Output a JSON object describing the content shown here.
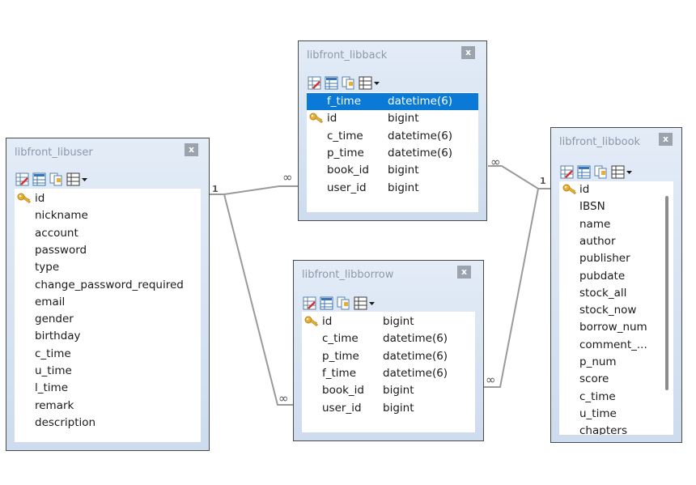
{
  "tables": {
    "libuser": {
      "title": "libfront_libuser",
      "close": "x",
      "fields": [
        {
          "name": "id",
          "type": ""
        },
        {
          "name": "nickname",
          "type": ""
        },
        {
          "name": "account",
          "type": ""
        },
        {
          "name": "password",
          "type": ""
        },
        {
          "name": "type",
          "type": ""
        },
        {
          "name": "change_password_required",
          "type": ""
        },
        {
          "name": "email",
          "type": ""
        },
        {
          "name": "gender",
          "type": ""
        },
        {
          "name": "birthday",
          "type": ""
        },
        {
          "name": "c_time",
          "type": ""
        },
        {
          "name": "u_time",
          "type": ""
        },
        {
          "name": "l_time",
          "type": ""
        },
        {
          "name": "remark",
          "type": ""
        },
        {
          "name": "description",
          "type": ""
        }
      ]
    },
    "libback": {
      "title": "libfront_libback",
      "close": "x",
      "fields": [
        {
          "name": "f_time",
          "type": "datetime(6)"
        },
        {
          "name": "id",
          "type": "bigint"
        },
        {
          "name": "c_time",
          "type": "datetime(6)"
        },
        {
          "name": "p_time",
          "type": "datetime(6)"
        },
        {
          "name": "book_id",
          "type": "bigint"
        },
        {
          "name": "user_id",
          "type": "bigint"
        }
      ]
    },
    "libborrow": {
      "title": "libfront_libborrow",
      "close": "x",
      "fields": [
        {
          "name": "id",
          "type": "bigint"
        },
        {
          "name": "c_time",
          "type": "datetime(6)"
        },
        {
          "name": "p_time",
          "type": "datetime(6)"
        },
        {
          "name": "f_time",
          "type": "datetime(6)"
        },
        {
          "name": "book_id",
          "type": "bigint"
        },
        {
          "name": "user_id",
          "type": "bigint"
        }
      ]
    },
    "libbook": {
      "title": "libfront_libbook",
      "close": "x",
      "fields": [
        {
          "name": "id",
          "type": ""
        },
        {
          "name": "IBSN",
          "type": ""
        },
        {
          "name": "name",
          "type": ""
        },
        {
          "name": "author",
          "type": ""
        },
        {
          "name": "publisher",
          "type": ""
        },
        {
          "name": "pubdate",
          "type": ""
        },
        {
          "name": "stock_all",
          "type": ""
        },
        {
          "name": "stock_now",
          "type": ""
        },
        {
          "name": "borrow_num",
          "type": ""
        },
        {
          "name": "comment_...",
          "type": ""
        },
        {
          "name": "p_num",
          "type": ""
        },
        {
          "name": "score",
          "type": ""
        },
        {
          "name": "c_time",
          "type": ""
        },
        {
          "name": "u_time",
          "type": ""
        },
        {
          "name": "chapters",
          "type": ""
        }
      ]
    }
  },
  "relations": {
    "one": "1",
    "many": "∞"
  },
  "icons": {
    "primary_key": "key-icon",
    "toolbar": [
      "table-edit-icon",
      "table-design-icon",
      "copy-table-icon",
      "table-grid-icon",
      "dropdown-arrow-icon"
    ]
  },
  "colors": {
    "selection": "#0a7ad6",
    "title_text": "#8c99aa",
    "key": "#e8b030",
    "line": "#9a9a9a"
  }
}
